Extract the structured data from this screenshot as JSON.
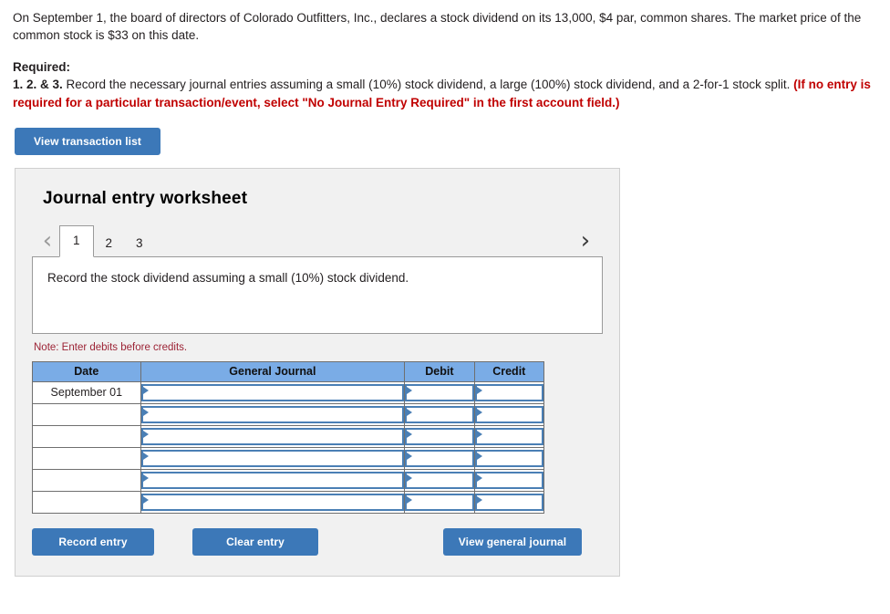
{
  "problem": {
    "statement": "On September 1, the board of directors of Colorado Outfitters, Inc., declares a stock dividend on its 13,000, $4 par, common shares. The market price of the common stock is $33 on this date.",
    "required_label": "Required:",
    "required_numbers": "1. 2. & 3.",
    "required_text": " Record the necessary journal entries assuming a small (10%) stock dividend, a large (100%) stock dividend, and a 2-for-1 stock split. ",
    "required_note_red": "(If no entry is required for a particular transaction/event, select \"No Journal Entry Required\" in the first account field.)"
  },
  "toolbar": {
    "view_transaction_list_label": "View transaction list"
  },
  "worksheet": {
    "title": "Journal entry worksheet",
    "prev_icon": "‹",
    "next_icon": "›",
    "tabs": [
      {
        "label": "1",
        "active": true
      },
      {
        "label": "2",
        "active": false
      },
      {
        "label": "3",
        "active": false
      }
    ],
    "instruction": "Record the stock dividend assuming a small (10%) stock dividend.",
    "note": "Note: Enter debits before credits.",
    "table": {
      "headers": [
        "Date",
        "General Journal",
        "Debit",
        "Credit"
      ],
      "rows": [
        {
          "date": "September 01",
          "general_journal": "",
          "debit": "",
          "credit": ""
        },
        {
          "date": "",
          "general_journal": "",
          "debit": "",
          "credit": ""
        },
        {
          "date": "",
          "general_journal": "",
          "debit": "",
          "credit": ""
        },
        {
          "date": "",
          "general_journal": "",
          "debit": "",
          "credit": ""
        },
        {
          "date": "",
          "general_journal": "",
          "debit": "",
          "credit": ""
        },
        {
          "date": "",
          "general_journal": "",
          "debit": "",
          "credit": ""
        }
      ]
    },
    "actions": {
      "record_entry_label": "Record entry",
      "clear_entry_label": "Clear entry",
      "view_general_journal_label": "View general journal"
    }
  },
  "colors": {
    "button_blue": "#3c78b8",
    "header_blue": "#7aace6",
    "field_border_blue": "#4a7fb5",
    "note_red": "#9c2335",
    "required_red": "#c00000",
    "panel_gray": "#f1f1f1"
  }
}
